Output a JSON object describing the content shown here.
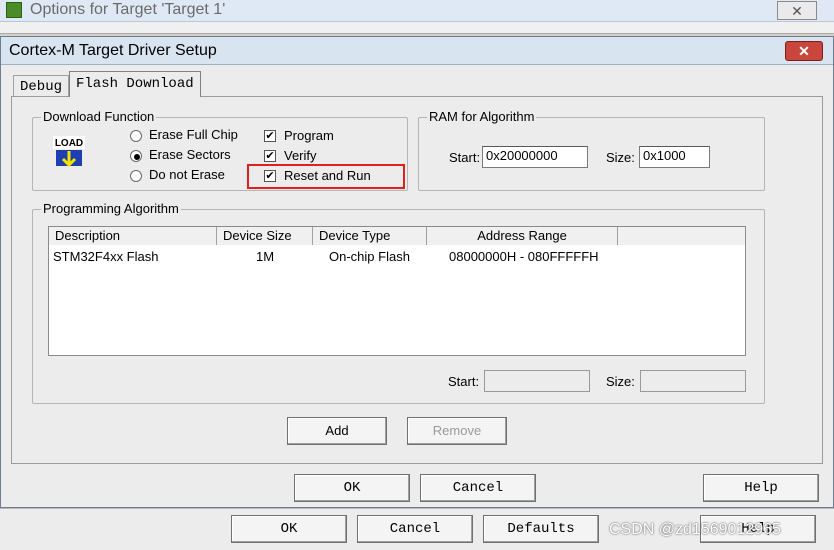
{
  "back_window": {
    "title": "Options for Target 'Target 1'",
    "close": "✕",
    "buttons": {
      "ok": "OK",
      "cancel": "Cancel",
      "defaults": "Defaults",
      "help": "Help"
    }
  },
  "dialog": {
    "title": "Cortex-M Target Driver Setup",
    "close": "✕",
    "tabs": [
      "Debug",
      "Flash Download"
    ],
    "download_function": {
      "legend": "Download Function",
      "icon_label": "LOAD",
      "radios": [
        {
          "label": "Erase Full Chip",
          "selected": false
        },
        {
          "label": "Erase Sectors",
          "selected": true
        },
        {
          "label": "Do not Erase",
          "selected": false
        }
      ],
      "checks": [
        {
          "label": "Program",
          "checked": true
        },
        {
          "label": "Verify",
          "checked": true
        },
        {
          "label": "Reset and Run",
          "checked": true
        }
      ]
    },
    "ram": {
      "legend": "RAM for Algorithm",
      "start_label": "Start:",
      "start_value": "0x20000000",
      "size_label": "Size:",
      "size_value": "0x1000"
    },
    "programming": {
      "legend": "Programming Algorithm",
      "columns": [
        "Description",
        "Device Size",
        "Device Type",
        "Address Range"
      ],
      "rows": [
        [
          "STM32F4xx Flash",
          "1M",
          "On-chip Flash",
          "08000000H - 080FFFFFH"
        ]
      ],
      "start_label": "Start:",
      "size_label": "Size:",
      "start_value": "",
      "size_value": ""
    },
    "buttons": {
      "add": "Add",
      "remove": "Remove",
      "ok": "OK",
      "cancel": "Cancel",
      "help": "Help"
    }
  },
  "watermark": "CSDN @zd1569012965",
  "colors": {
    "highlight": "#e0201b",
    "titlebar": "#d9e4f1",
    "close": "#c9463d"
  }
}
